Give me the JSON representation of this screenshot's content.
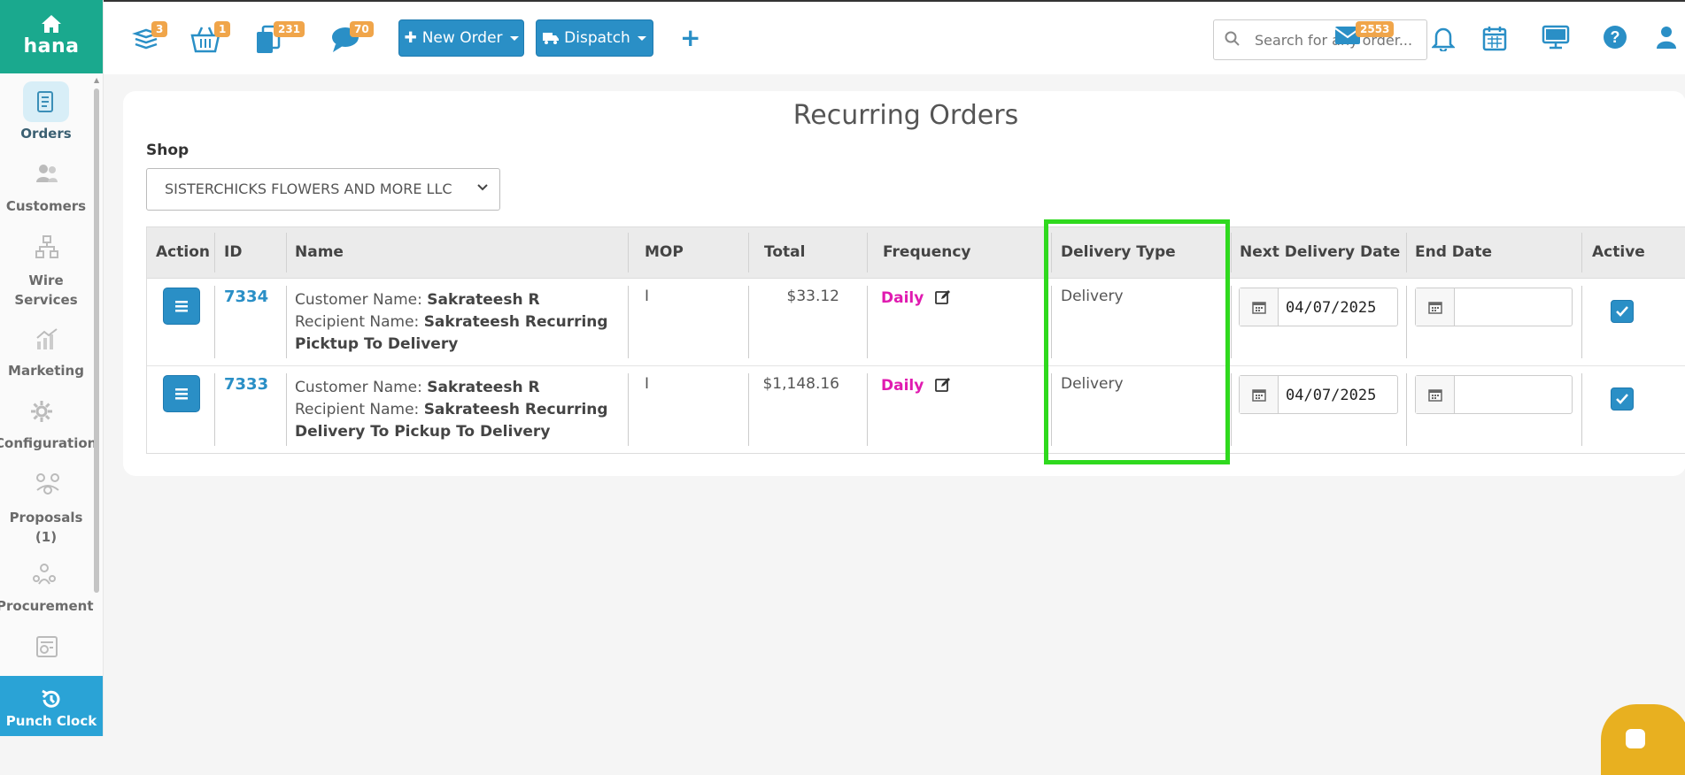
{
  "brand": {
    "name": "hana",
    "color": "#1aa98e"
  },
  "sidebar": {
    "items": [
      {
        "label": "Orders",
        "icon": "orders-icon",
        "active": true
      },
      {
        "label": "Customers",
        "icon": "customers-icon"
      },
      {
        "label": "Wire Services",
        "line1": "Wire",
        "line2": "Services",
        "icon": "wire-services-icon"
      },
      {
        "label": "Marketing",
        "icon": "marketing-icon"
      },
      {
        "label": "Configuration",
        "icon": "configuration-icon"
      },
      {
        "label": "Proposals (1)",
        "line1": "Proposals",
        "line2": "(1)",
        "icon": "proposals-icon"
      },
      {
        "label": "Procurement",
        "icon": "procurement-icon"
      },
      {
        "label": "",
        "icon": "reports-icon"
      }
    ],
    "punch_clock": "Punch Clock"
  },
  "topbar": {
    "badges": {
      "tasks": "3",
      "cart": "1",
      "copies": "231",
      "chat": "70",
      "mail": "2553"
    },
    "new_order_label": "New Order",
    "dispatch_label": "Dispatch",
    "add_label": "+",
    "search_placeholder": "Search for any order..."
  },
  "page": {
    "title": "Recurring Orders",
    "shop_label": "Shop",
    "shop_value": "SISTERCHICKS FLOWERS AND MORE LLC"
  },
  "table": {
    "headers": {
      "action": "Action",
      "id": "ID",
      "name": "Name",
      "mop": "MOP",
      "total": "Total",
      "frequency": "Frequency",
      "delivery_type": "Delivery Type",
      "next_delivery_date": "Next Delivery Date",
      "end_date": "End Date",
      "active": "Active"
    },
    "rows": [
      {
        "id": "7334",
        "customer_label": "Customer Name: ",
        "customer_name": "Sakrateesh R",
        "recipient_label": "Recipient Name: ",
        "recipient_name": "Sakrateesh Recurring Picktup To Delivery",
        "mop": "I",
        "total": "$33.12",
        "frequency": "Daily",
        "delivery_type": "Delivery",
        "next_delivery_date": "04/07/2025",
        "end_date": "",
        "active": true
      },
      {
        "id": "7333",
        "customer_label": "Customer Name: ",
        "customer_name": "Sakrateesh R",
        "recipient_label": "Recipient Name: ",
        "recipient_name": "Sakrateesh Recurring Delivery To Pickup To Delivery",
        "mop": "I",
        "total": "$1,148.16",
        "frequency": "Daily",
        "delivery_type": "Delivery",
        "next_delivery_date": "04/07/2025",
        "end_date": "",
        "active": true
      }
    ]
  },
  "colors": {
    "accent": "#2a8fc6",
    "frequency": "#e01bb0",
    "highlight": "#2fd91e",
    "badge": "#f0a54a"
  }
}
